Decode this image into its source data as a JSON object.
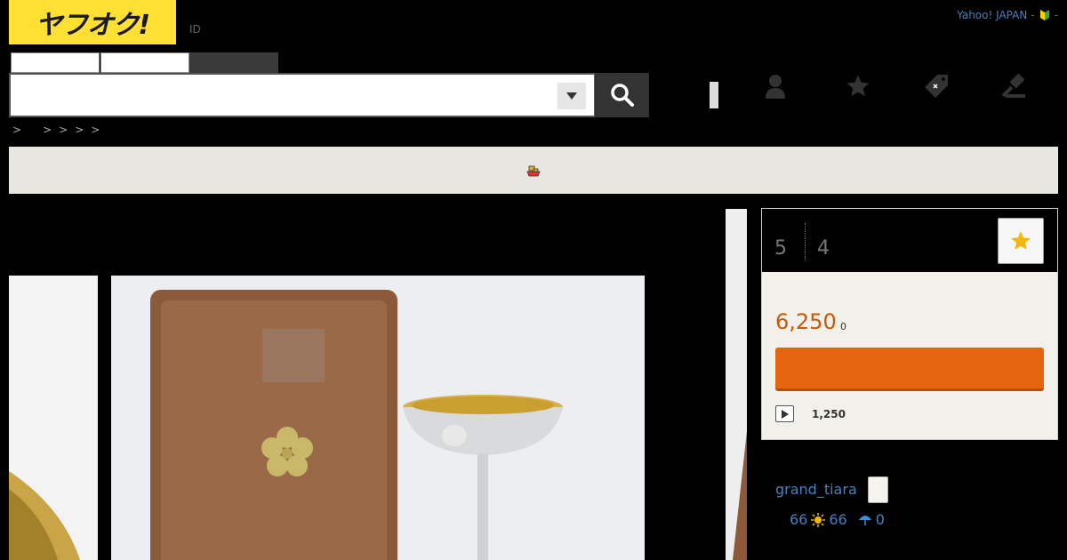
{
  "header": {
    "logo_text": "ヤフオク!",
    "id_label": "ID",
    "top_links": [
      "Yahoo! JAPAN",
      "-",
      "-"
    ]
  },
  "search": {
    "placeholder": "",
    "value": ""
  },
  "breadcrumb": [
    ">",
    ">",
    ">",
    ">",
    ">"
  ],
  "item": {
    "counters": {
      "first": "5",
      "second": "4"
    },
    "price": "6,250",
    "tax": "0",
    "buyout_price": "1,250"
  },
  "seller": {
    "name": "grand_tiara",
    "rating_total": "66",
    "rating_good": "66",
    "rating_bad": "0"
  },
  "colors": {
    "logo_yellow": "#ffe033",
    "bid_orange": "#e5650f",
    "price_orange": "#c45a0a",
    "link_blue": "#4a7fbf"
  }
}
